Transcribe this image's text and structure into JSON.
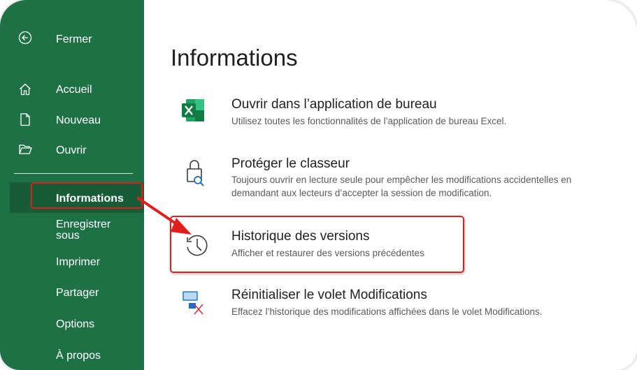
{
  "sidebar": {
    "close_label": "Fermer",
    "items": [
      {
        "label": "Accueil"
      },
      {
        "label": "Nouveau"
      },
      {
        "label": "Ouvrir"
      },
      {
        "label": "Informations"
      },
      {
        "label": "Enregistrer sous"
      },
      {
        "label": "Imprimer"
      },
      {
        "label": "Partager"
      },
      {
        "label": "Options"
      },
      {
        "label": "À propos"
      }
    ],
    "save_as_line1": "Enregistrer",
    "save_as_line2": "sous"
  },
  "main": {
    "title": "Informations",
    "items": [
      {
        "title": "Ouvrir dans l’application de bureau",
        "description": "Utilisez toutes les fonctionnalités de l’application de bureau Excel.",
        "icon": "excel-icon"
      },
      {
        "title": "Protéger le classeur",
        "description": "Toujours ouvrir en lecture seule pour empêcher les modifications accidentelles en demandant aux lecteurs d’accepter la session de modification.",
        "icon": "lock-search-icon"
      },
      {
        "title": "Historique des versions",
        "description": "Afficher et restaurer des versions précédentes",
        "icon": "history-icon"
      },
      {
        "title": "Réinitialiser le volet Modifications",
        "description": "Effacez l’historique des modifications affichées dans le volet Modifications.",
        "icon": "reset-pane-icon"
      }
    ]
  },
  "colors": {
    "sidebar_bg": "#1e7145",
    "sidebar_active": "#185c37",
    "annotation_red": "#e01e1e"
  }
}
